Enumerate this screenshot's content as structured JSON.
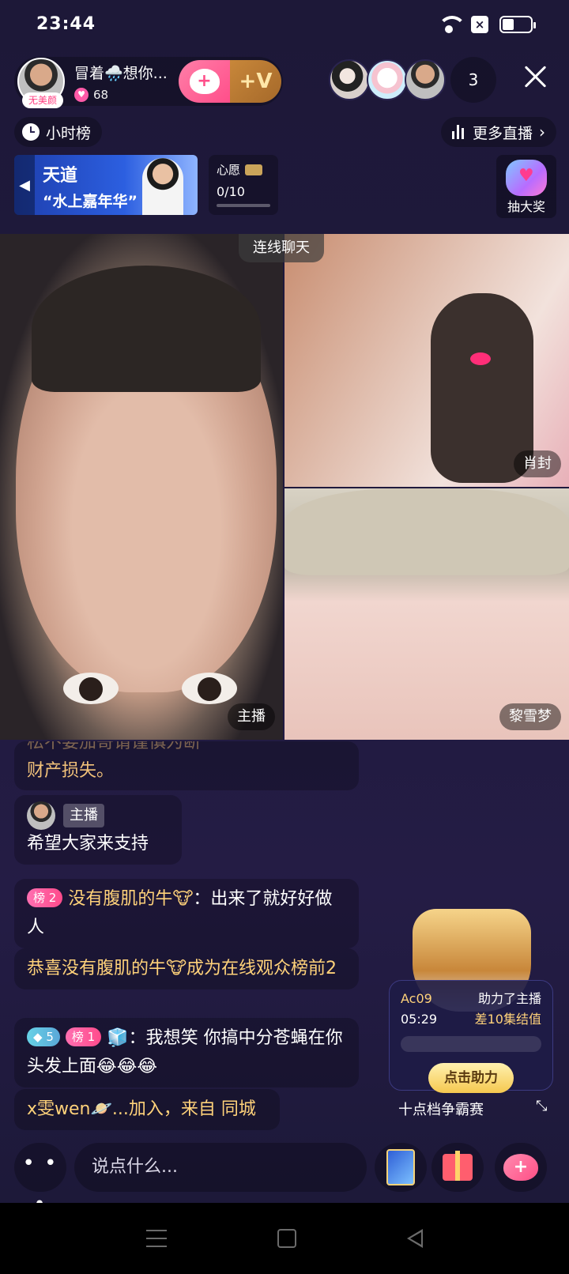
{
  "status": {
    "time": "23:44",
    "battery_percent": 40
  },
  "host": {
    "name": "冒着🌧️想你...",
    "likes": "68",
    "no_beauty_label": "无美颜"
  },
  "viewers": {
    "count": "3"
  },
  "hour_rank": {
    "label": "小时榜"
  },
  "more_live": {
    "label": "更多直播"
  },
  "banner": {
    "line1": "天道",
    "line2": "“水上嘉年华”"
  },
  "wish": {
    "title": "心愿",
    "progress": "0/10"
  },
  "lottery": {
    "label": "抽大奖"
  },
  "video": {
    "connect_label": "连线聊天",
    "main_tag": "主播",
    "guest1_tag": "肖封",
    "guest2_tag": "黎雪梦"
  },
  "chat": {
    "partial_hidden": "松不要加哥请谨慎为断",
    "partial_text": "财产损失。",
    "host_chip": "主播",
    "host_message": "希望大家来支持",
    "msg1": {
      "rank": "榜 2",
      "user": "没有腹肌的牛🐮",
      "text": "：出来了就好好做人"
    },
    "msg2": {
      "text": "恭喜没有腹肌的牛🐮成为在线观众榜前2"
    },
    "msg3": {
      "level": "5",
      "rank": "榜 1",
      "user": "🧊",
      "text": "：我想笑 你搞中分苍蝇在你头发上面😂😂😂"
    },
    "msg4": {
      "text": "x雯wen🪐...加入，来自 同城"
    }
  },
  "contest": {
    "code": "Ac09",
    "action": "助力了主播",
    "timer": "05:29",
    "gap": "差10集结值",
    "boost_label": "点击助力",
    "title": "十点档争霸赛"
  },
  "bottom": {
    "more_label": "• • •",
    "input_placeholder": "说点什么..."
  }
}
